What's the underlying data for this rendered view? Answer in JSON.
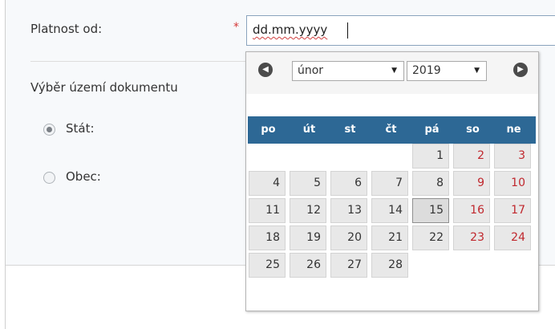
{
  "form": {
    "validity_label": "Platnost od:",
    "required_mark": "*",
    "date_value": "dd.mm.yyyy",
    "section_title": "Výběr území dokumentu",
    "options": [
      {
        "label": "Stát:",
        "checked": true
      },
      {
        "label": "Obec:",
        "checked": false
      }
    ]
  },
  "datepicker": {
    "month": "únor",
    "year": "2019",
    "weekdays": [
      "po",
      "út",
      "st",
      "čt",
      "pá",
      "so",
      "ne"
    ],
    "weeks": [
      [
        "",
        "",
        "",
        "",
        "1",
        "2",
        "3"
      ],
      [
        "4",
        "5",
        "6",
        "7",
        "8",
        "9",
        "10"
      ],
      [
        "11",
        "12",
        "13",
        "14",
        "15",
        "16",
        "17"
      ],
      [
        "18",
        "19",
        "20",
        "21",
        "22",
        "23",
        "24"
      ],
      [
        "25",
        "26",
        "27",
        "28",
        "",
        "",
        ""
      ]
    ],
    "today": "15",
    "colors": {
      "header": "#2d6895",
      "weekend": "#c0272d"
    }
  }
}
